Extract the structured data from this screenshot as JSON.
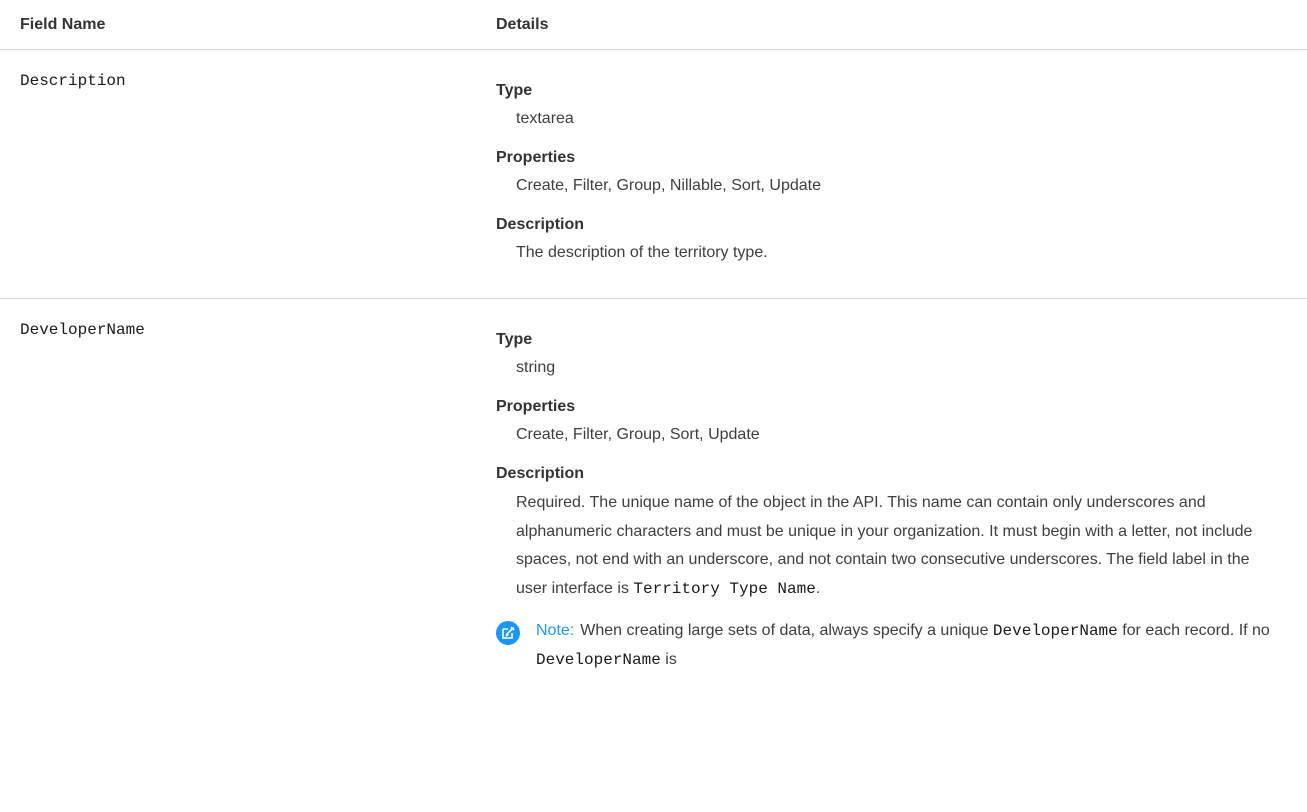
{
  "header": {
    "field_name": "Field Name",
    "details": "Details"
  },
  "rows": [
    {
      "field": "Description",
      "type_label": "Type",
      "type_value": "textarea",
      "properties_label": "Properties",
      "properties_value": "Create, Filter, Group, Nillable, Sort, Update",
      "description_label": "Description",
      "description_value": "The description of the territory type."
    },
    {
      "field": "DeveloperName",
      "type_label": "Type",
      "type_value": "string",
      "properties_label": "Properties",
      "properties_value": "Create, Filter, Group, Sort, Update",
      "description_label": "Description",
      "description_text": "Required. The unique name of the object in the API. This name can contain only underscores and alphanumeric characters and must be unique in your organization. It must begin with a letter, not include spaces, not end with an underscore, and not contain two consecutive underscores. The field label in the user interface is ",
      "description_code": "Territory Type Name",
      "description_end": ".",
      "note": {
        "icon": "edit-note-icon",
        "label": "Note:",
        "text_1": "When creating large sets of data, always specify a unique ",
        "code_1": "DeveloperName",
        "text_2": " for each record. If no ",
        "code_2": "DeveloperName",
        "text_3": " is"
      }
    }
  ],
  "colors": {
    "note_accent": "#1b96ff",
    "divider": "#d8d8d8"
  }
}
